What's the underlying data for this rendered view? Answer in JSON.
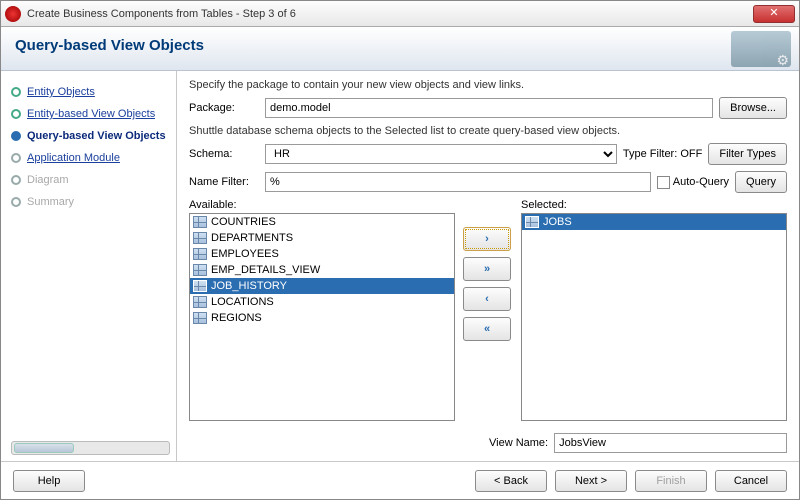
{
  "window": {
    "title": "Create Business Components from Tables - Step 3 of 6"
  },
  "header": {
    "title": "Query-based View Objects"
  },
  "sidebar": {
    "steps": [
      {
        "label": "Entity Objects",
        "state": "done",
        "link": true
      },
      {
        "label": "Entity-based View Objects",
        "state": "done",
        "link": true
      },
      {
        "label": "Query-based View Objects",
        "state": "current",
        "link": true
      },
      {
        "label": "Application Module",
        "state": "future",
        "link": true
      },
      {
        "label": "Diagram",
        "state": "disabled",
        "link": false
      },
      {
        "label": "Summary",
        "state": "disabled",
        "link": false
      }
    ]
  },
  "main": {
    "desc1": "Specify the package to contain your new view objects and view links.",
    "packageLabel": "Package:",
    "packageValue": "demo.model",
    "browse": "Browse...",
    "desc2": "Shuttle database schema objects to the Selected list to create query-based view objects.",
    "schemaLabel": "Schema:",
    "schemaValue": "HR",
    "typeFilterLabel": "Type Filter: OFF",
    "filterTypes": "Filter Types",
    "nameFilterLabel": "Name Filter:",
    "nameFilterValue": "%",
    "autoQuery": "Auto-Query",
    "query": "Query",
    "availableLabel": "Available:",
    "selectedLabel": "Selected:",
    "available": [
      "COUNTRIES",
      "DEPARTMENTS",
      "EMPLOYEES",
      "EMP_DETAILS_VIEW",
      "JOB_HISTORY",
      "LOCATIONS",
      "REGIONS"
    ],
    "availableSelectedIndex": 4,
    "selected": [
      "JOBS"
    ],
    "selectedSelectedIndex": 0,
    "viewNameLabel": "View Name:",
    "viewNameValue": "JobsView"
  },
  "footer": {
    "help": "Help",
    "back": "< Back",
    "next": "Next >",
    "finish": "Finish",
    "cancel": "Cancel"
  }
}
